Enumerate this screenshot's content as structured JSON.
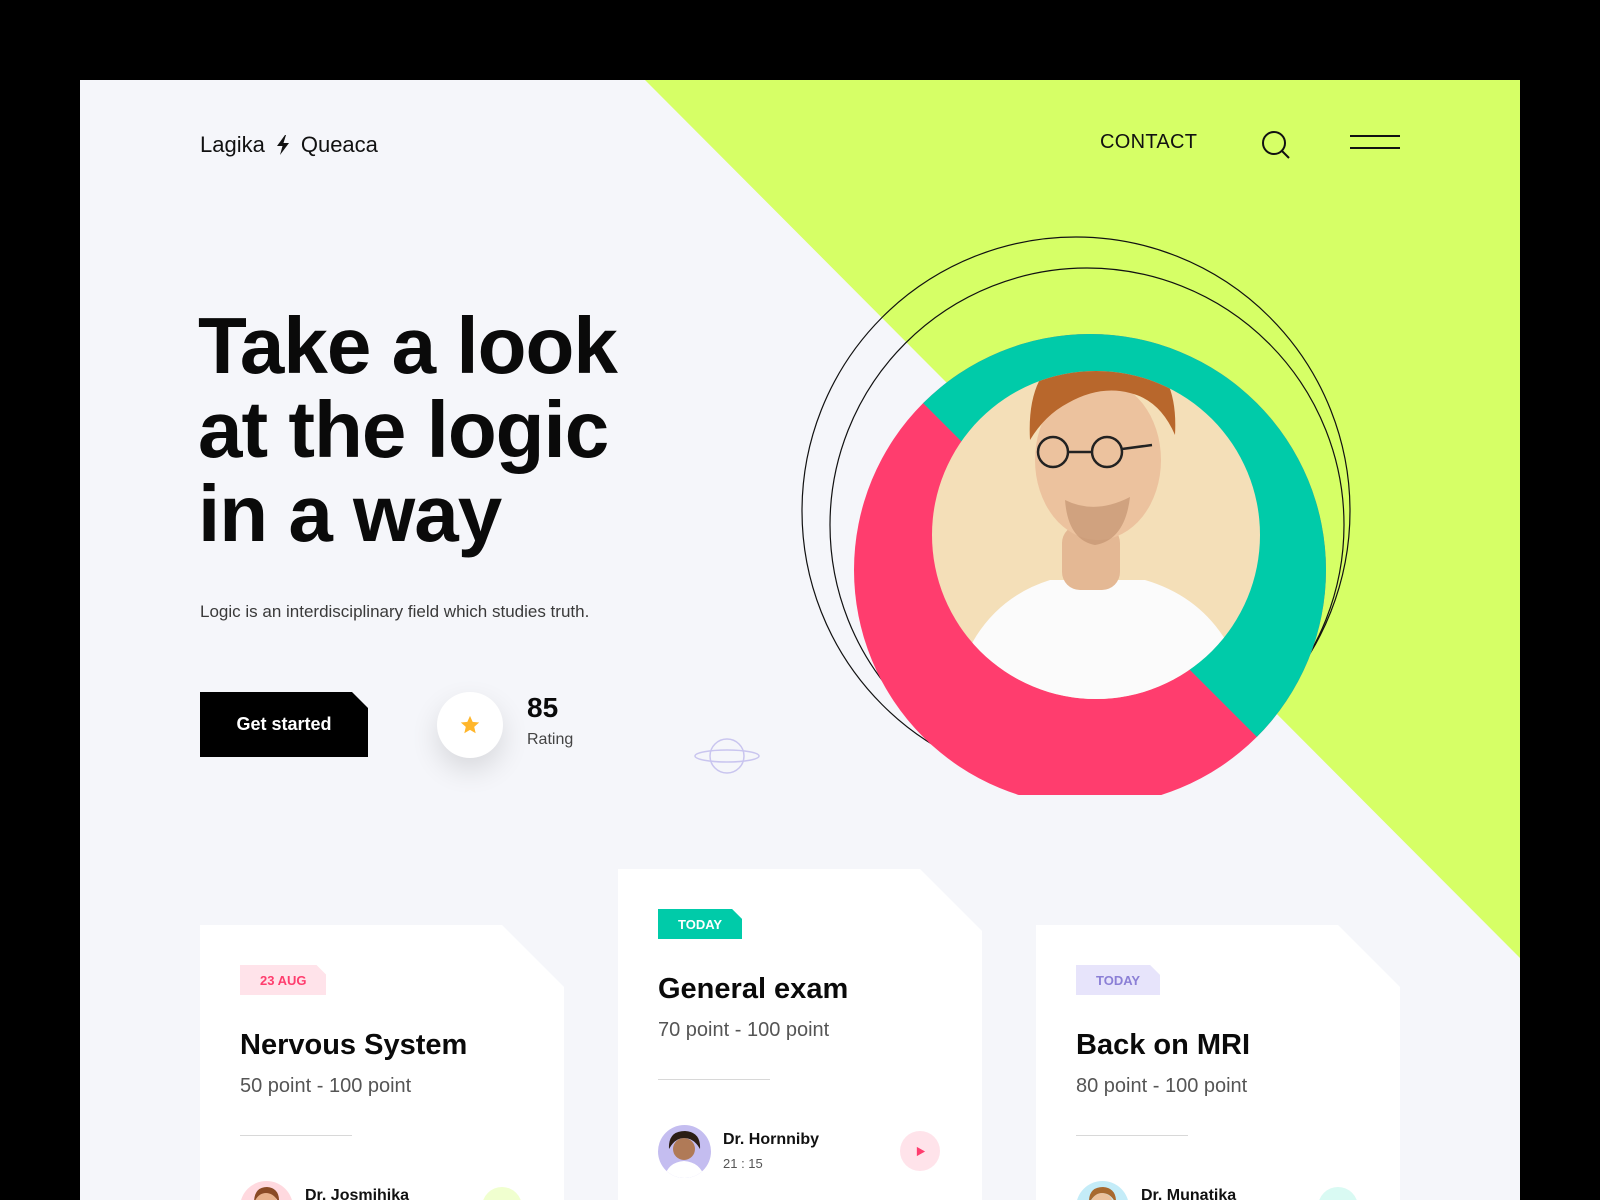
{
  "brand": {
    "left": "Lagika",
    "right": "Queaca"
  },
  "nav": {
    "contact": "CONTACT"
  },
  "hero": {
    "headline": [
      "Take a look",
      "at the logic",
      "in a way"
    ],
    "subtext": "Logic is an interdisciplinary field which studies truth.",
    "cta": "Get started",
    "rating_value": "85",
    "rating_label": "Rating"
  },
  "cards": [
    {
      "tag": "23 AUG",
      "title": "Nervous System",
      "points": "50 point - 100 point",
      "doctor": "Dr. Josmihika",
      "time": ""
    },
    {
      "tag": "TODAY",
      "title": "General exam",
      "points": "70 point - 100 point",
      "doctor": "Dr. Hornniby",
      "time": "21 : 15"
    },
    {
      "tag": "TODAY",
      "title": "Back on MRI",
      "points": "80 point - 100 point",
      "doctor": "Dr. Munatika",
      "time": ""
    }
  ],
  "colors": {
    "lime": "#d6ff66",
    "teal": "#00cba9",
    "pink": "#ff3d6e",
    "skin": "#f4dfb8",
    "star": "#ffb62b",
    "lavender": "#8b7fd6"
  },
  "icons": [
    "bolt-icon",
    "search-icon",
    "menu-icon",
    "star-icon",
    "planet-icon",
    "play-icon"
  ]
}
